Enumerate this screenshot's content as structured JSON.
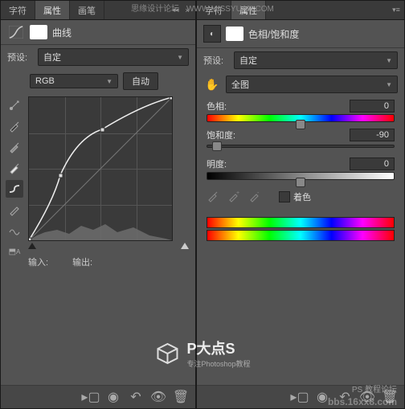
{
  "watermarks": {
    "top_cn": "思缘设计论坛",
    "top_url": "WWW.MISSYUAN.COM",
    "logo_title": "P大点S",
    "logo_sub": "专注Photoshop教程",
    "br": "PS 教程论坛",
    "bb": "bbs.16xx8.com"
  },
  "tabs_left": {
    "t0": "字符",
    "t1": "属性",
    "t2": "画笔"
  },
  "tabs_right": {
    "t0": "字符",
    "t1": "属性"
  },
  "curves": {
    "title": "曲线",
    "preset_label": "预设:",
    "preset_value": "自定",
    "channel": "RGB",
    "auto": "自动",
    "input_label": "输入:",
    "output_label": "输出:"
  },
  "hsl": {
    "title": "色相/饱和度",
    "preset_label": "预设:",
    "preset_value": "自定",
    "range": "全图",
    "hue_label": "色相:",
    "hue_value": "0",
    "sat_label": "饱和度:",
    "sat_value": "-90",
    "light_label": "明度:",
    "light_value": "0",
    "colorize": "着色"
  },
  "chart_data": {
    "type": "line",
    "title": "曲线 (Curves)",
    "xlabel": "输入",
    "ylabel": "输出",
    "xlim": [
      0,
      255
    ],
    "ylim": [
      0,
      255
    ],
    "series": [
      {
        "name": "RGB",
        "points": [
          {
            "x": 0,
            "y": 0
          },
          {
            "x": 56,
            "y": 116
          },
          {
            "x": 131,
            "y": 198
          },
          {
            "x": 255,
            "y": 255
          }
        ]
      }
    ],
    "histogram_present": true
  }
}
